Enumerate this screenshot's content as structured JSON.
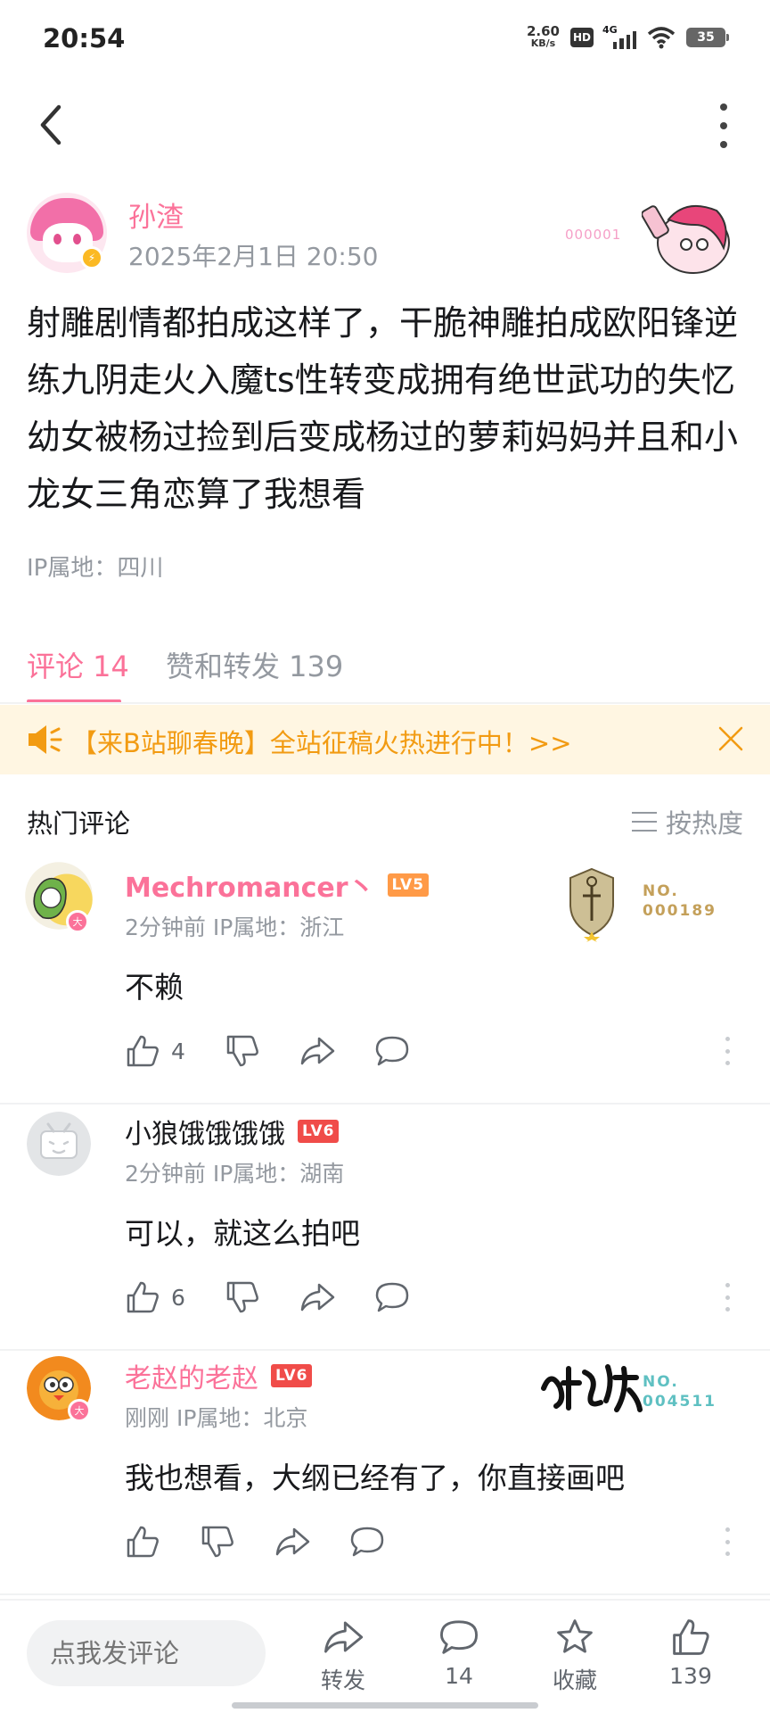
{
  "status_bar": {
    "time": "20:54",
    "net_speed": "2.60",
    "net_unit": "KB/s",
    "hd": "HD",
    "signal": "4G",
    "battery": "35"
  },
  "post": {
    "author": "孙渣",
    "time": "2025年2月1日 20:50",
    "decor_text": "000001",
    "body": "射雕剧情都拍成这样了，干脆神雕拍成欧阳锋逆练九阴走火入魔ts性转变成拥有绝世武功的失忆幼女被杨过捡到后变成杨过的萝莉妈妈并且和小龙女三角恋算了我想看",
    "ip": "IP属地：四川"
  },
  "tabs": {
    "comments": "评论 14",
    "likes": "赞和转发 139"
  },
  "banner": {
    "text": "【来B站聊春晚】全站征稿火热进行中！>>"
  },
  "section": {
    "title": "热门评论",
    "sort_label": "按热度"
  },
  "comments": [
    {
      "name": "Mechromancer丶",
      "level": "LV5",
      "meta": "2分钟前  IP属地：浙江",
      "text": "不赖",
      "likes": "4",
      "fan_no_label": "NO.",
      "fan_no": "000189",
      "name_color": "#fb7299",
      "level_color": "#ff9a47"
    },
    {
      "name": "小狼饿饿饿饿",
      "level": "LV6",
      "meta": "2分钟前  IP属地：湖南",
      "text": "可以，就这么拍吧",
      "likes": "6",
      "name_color": "#18191c",
      "level_color": "#f04c49"
    },
    {
      "name": "老赵的老赵",
      "level": "LV6",
      "meta": "刚刚  IP属地：北京",
      "text": "我也想看，大纲已经有了，你直接画吧",
      "likes": "",
      "fan_no_label": "NO.",
      "fan_no": "004511",
      "name_color": "#fb7299",
      "level_color": "#f04c49"
    }
  ],
  "bottom_bar": {
    "input_placeholder": "点我发评论",
    "share_label": "转发",
    "comment_count": "14",
    "favorite_label": "收藏",
    "like_count": "139"
  },
  "colors": {
    "accent": "#fb7299",
    "banner_text": "#f29b12",
    "banner_bg": "#fff6e2",
    "muted": "#9499a0"
  },
  "icons": [
    "back-icon",
    "more-icon",
    "speaker-icon",
    "close-icon",
    "sort-icon",
    "thumb-up-icon",
    "thumb-down-icon",
    "share-icon",
    "comment-icon",
    "star-icon"
  ]
}
